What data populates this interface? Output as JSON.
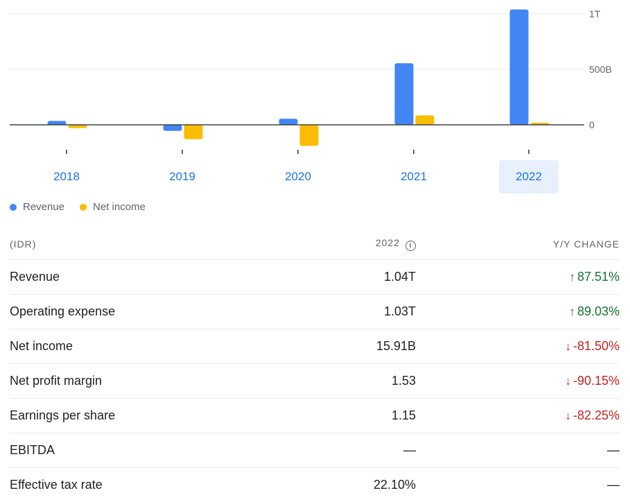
{
  "chart_data": {
    "type": "bar",
    "categories": [
      "2018",
      "2019",
      "2020",
      "2021",
      "2022"
    ],
    "series": [
      {
        "name": "Revenue",
        "color": "#4285f4",
        "values": [
          35,
          -55,
          55,
          555,
          1040
        ]
      },
      {
        "name": "Net income",
        "color": "#fbbc04",
        "values": [
          -30,
          -130,
          -190,
          85,
          15.91
        ]
      }
    ],
    "units": "B",
    "yticks": [
      {
        "value": 0,
        "label": "0"
      },
      {
        "value": 500,
        "label": "500B"
      },
      {
        "value": 1000,
        "label": "1T"
      }
    ],
    "ylim": [
      -200,
      1040
    ],
    "selected_category": "2022"
  },
  "legend": [
    {
      "label": "Revenue",
      "color": "#4285f4"
    },
    {
      "label": "Net income",
      "color": "#fbbc04"
    }
  ],
  "table": {
    "currency_label": "(IDR)",
    "year_label": "2022",
    "change_label": "Y/Y CHANGE",
    "rows": [
      {
        "label": "Revenue",
        "value": "1.04T",
        "change": "87.51%",
        "direction": "up"
      },
      {
        "label": "Operating expense",
        "value": "1.03T",
        "change": "89.03%",
        "direction": "up"
      },
      {
        "label": "Net income",
        "value": "15.91B",
        "change": "-81.50%",
        "direction": "down"
      },
      {
        "label": "Net profit margin",
        "value": "1.53",
        "change": "-90.15%",
        "direction": "down"
      },
      {
        "label": "Earnings per share",
        "value": "1.15",
        "change": "-82.25%",
        "direction": "down"
      },
      {
        "label": "EBITDA",
        "value": "—",
        "change": "—",
        "direction": "none"
      },
      {
        "label": "Effective tax rate",
        "value": "22.10%",
        "change": "—",
        "direction": "none"
      }
    ]
  }
}
